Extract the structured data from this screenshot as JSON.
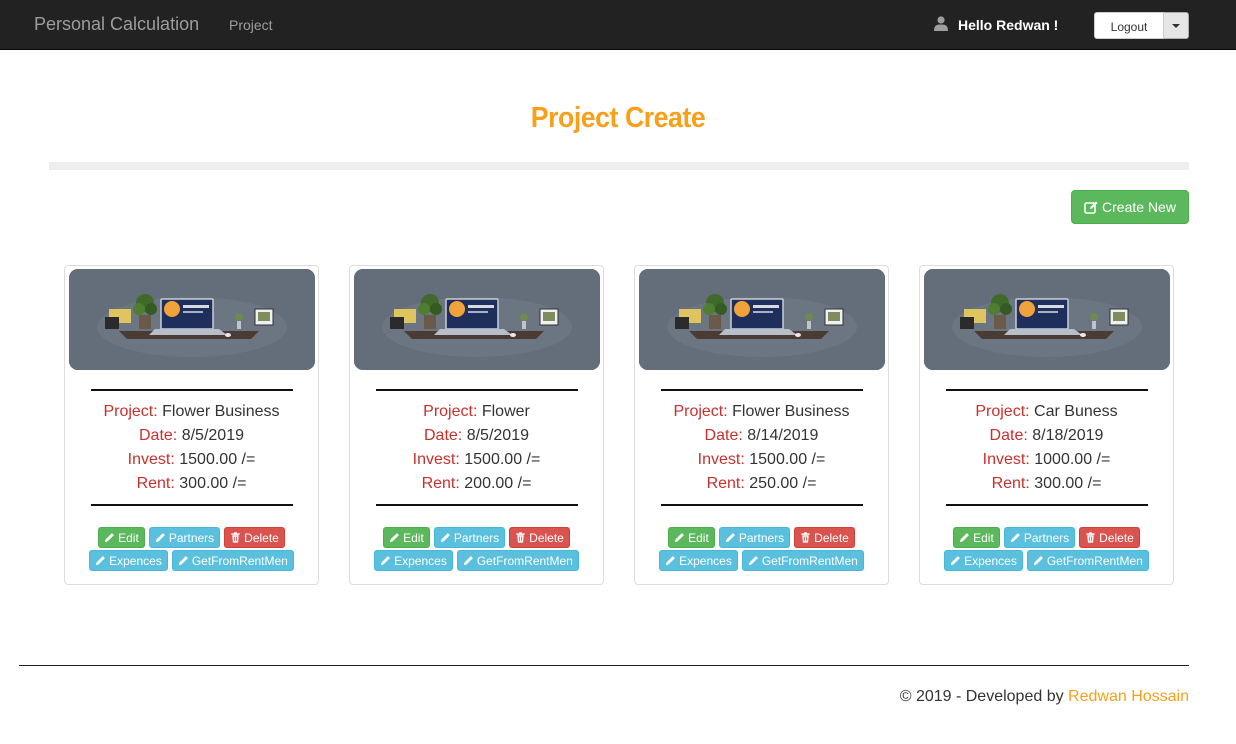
{
  "navbar": {
    "brand": "Personal Calculation",
    "link": "Project",
    "greeting": "Hello Redwan !",
    "logout_label": "Logout"
  },
  "page": {
    "title": "Project Create",
    "create_label": "Create New"
  },
  "labels": {
    "project": "Project:",
    "date": "Date:",
    "invest": "Invest:",
    "rent": "Rent:"
  },
  "buttons": {
    "edit": "Edit",
    "partners": "Partners",
    "delete": "Delete",
    "expences": "Expences",
    "get_from_rent": "GetFromRentMen"
  },
  "projects": [
    {
      "name": "Flower Business",
      "date": "8/5/2019",
      "invest": "1500.00 /=",
      "rent": "300.00 /="
    },
    {
      "name": "Flower",
      "date": "8/5/2019",
      "invest": "1500.00 /=",
      "rent": "200.00 /="
    },
    {
      "name": "Flower Business",
      "date": "8/14/2019",
      "invest": "1500.00 /=",
      "rent": "250.00 /="
    },
    {
      "name": "Car Buness",
      "date": "8/18/2019",
      "invest": "1000.00 /=",
      "rent": "300.00 /="
    }
  ],
  "footer": {
    "text": "© 2019 - Developed by",
    "author": "Redwan Hossain"
  },
  "colors": {
    "accent": "#f8a01c",
    "label_red": "#c9302c",
    "success": "#5cb85c",
    "info": "#5bc0de",
    "danger": "#d9534f",
    "navbar": "#222222"
  }
}
